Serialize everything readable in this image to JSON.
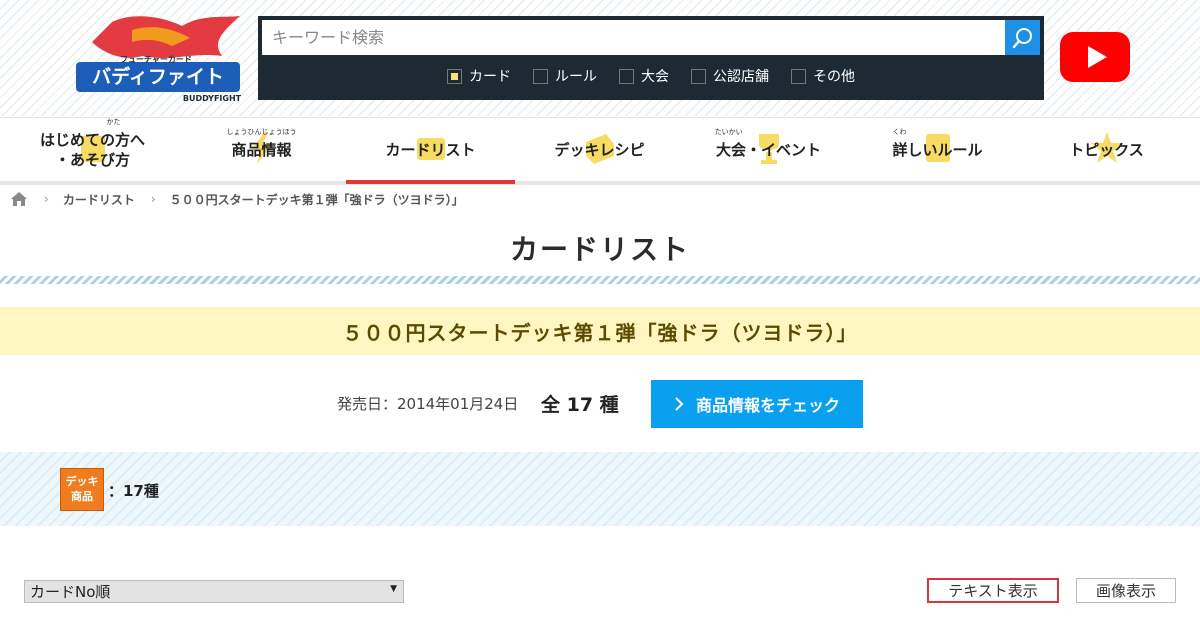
{
  "header": {
    "logo_alt": "フューチャーカード バディファイト BUDDYFIGHT",
    "search_placeholder": "キーワード検索",
    "filters": [
      {
        "label": "カード",
        "checked": true
      },
      {
        "label": "ルール",
        "checked": false
      },
      {
        "label": "大会",
        "checked": false
      },
      {
        "label": "公認店舗",
        "checked": false
      },
      {
        "label": "その他",
        "checked": false
      }
    ]
  },
  "nav": {
    "items": [
      {
        "label": "はじめての方へ\n・あそび方",
        "ruby": "かた"
      },
      {
        "label": "商品情報",
        "ruby": "しょうひんじょうほう"
      },
      {
        "label": "カードリスト",
        "ruby": ""
      },
      {
        "label": "デッキレシピ",
        "ruby": ""
      },
      {
        "label": "大会・イベント",
        "ruby": "たいかい"
      },
      {
        "label": "詳しいルール",
        "ruby": "くわ"
      },
      {
        "label": "トピックス",
        "ruby": ""
      }
    ],
    "active_index": 2
  },
  "breadcrumb": {
    "items": [
      "カードリスト",
      "５００円スタートデッキ第１弾「強ドラ（ツヨドラ）」"
    ]
  },
  "page": {
    "title": "カードリスト",
    "product_name": "５００円スタートデッキ第１弾「強ドラ（ツヨドラ）」",
    "release_date": "発売日：2014年01月24日",
    "count_label": "全 17 種",
    "check_button": "商品情報をチェック",
    "deck_badge_top": "デッキ",
    "deck_badge_bottom": "商品",
    "deck_count": "：17種",
    "sort_value": "カードNo順",
    "view_text_label": "テキスト表示",
    "view_image_label": "画像表示"
  },
  "colors": {
    "accent_blue": "#0aa0f0",
    "active_red": "#e0383a",
    "product_band": "#fff6c2",
    "deck_orange": "#ef7d1f"
  }
}
